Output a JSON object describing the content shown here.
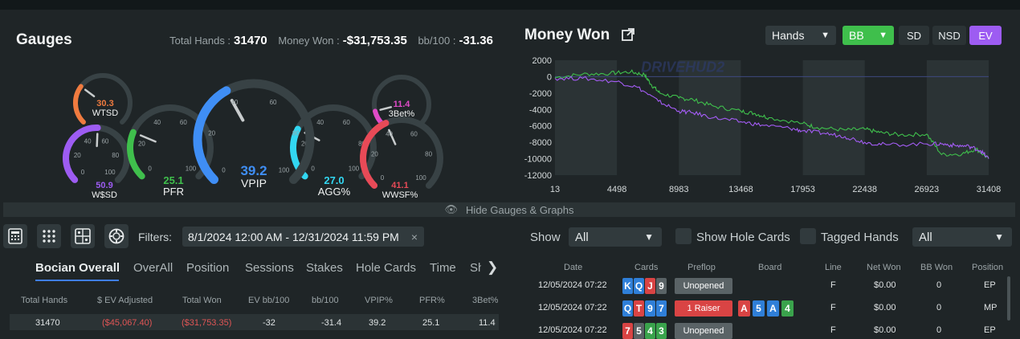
{
  "gauges": {
    "title": "Gauges",
    "total_hands_label": "Total Hands :",
    "total_hands": "31470",
    "money_won_label": "Money Won :",
    "money_won": "-$31,753.35",
    "bb100_label": "bb/100 :",
    "bb100": "-31.36",
    "items": [
      {
        "name": "WTSD",
        "value": "30.3",
        "color": "#f07b3f"
      },
      {
        "name": "W$SD",
        "value": "50.9",
        "color": "#9d5cf2"
      },
      {
        "name": "PFR",
        "value": "25.1",
        "color": "#3fbf4c"
      },
      {
        "name": "VPIP",
        "value": "39.2",
        "color": "#3f8ef5"
      },
      {
        "name": "AGG%",
        "value": "27.0",
        "color": "#32d7f2"
      },
      {
        "name": "3Bet%",
        "value": "11.4",
        "color": "#e04bc8"
      },
      {
        "name": "WWSF%",
        "value": "41.1",
        "color": "#e84a57"
      }
    ],
    "ticks": [
      "0",
      "20",
      "40",
      "60",
      "80",
      "100"
    ]
  },
  "money": {
    "title": "Money Won",
    "hands_select": "Hands",
    "bb_select": "BB",
    "sd": "SD",
    "nsd": "NSD",
    "ev": "EV",
    "watermark": "DRIVEHUD2"
  },
  "chart_data": {
    "type": "line",
    "x_ticks": [
      "13",
      "4498",
      "8983",
      "13468",
      "17953",
      "22438",
      "26923",
      "31408"
    ],
    "y_ticks": [
      "2000",
      "0",
      "-2000",
      "-4000",
      "-6000",
      "-8000",
      "-10000",
      "-12000"
    ],
    "ylim": [
      -12000,
      2000
    ],
    "xlim": [
      13,
      31408
    ],
    "series": [
      {
        "color": "#3fbf4c",
        "x": [
          13,
          2000,
          4000,
          5500,
          6500,
          7000,
          7600,
          8983,
          10000,
          11500,
          13468,
          14500,
          15500,
          17953,
          19000,
          21000,
          22438,
          23500,
          25000,
          26923,
          28000,
          29500,
          30500,
          31408
        ],
        "y": [
          -100,
          300,
          400,
          600,
          200,
          -1000,
          -2000,
          -2600,
          -2800,
          -3600,
          -4200,
          -4500,
          -5000,
          -5700,
          -6200,
          -6500,
          -6400,
          -6800,
          -7100,
          -7000,
          -9500,
          -9400,
          -8800,
          -10000
        ]
      },
      {
        "color": "#a45cf5",
        "x": [
          13,
          2000,
          4498,
          6000,
          7500,
          8983,
          10000,
          11500,
          13468,
          15000,
          17000,
          17953,
          19500,
          21000,
          22438,
          24000,
          26923,
          28000,
          29000,
          30000,
          30800,
          31408
        ],
        "y": [
          -200,
          -200,
          -600,
          -1300,
          -3000,
          -4200,
          -4400,
          -5000,
          -5500,
          -5900,
          -6300,
          -6600,
          -6900,
          -7300,
          -8000,
          -8300,
          -8200,
          -8200,
          -8400,
          -8500,
          -9000,
          -10000
        ]
      }
    ]
  },
  "hide_bar": "Hide Gauges & Graphs",
  "filters": {
    "label": "Filters:",
    "value": "8/1/2024 12:00 AM - 12/31/2024 11:59 PM",
    "clear": "×"
  },
  "stat_tabs": [
    "Bocian Overall",
    "OverAll",
    "Position",
    "Sessions",
    "Stakes",
    "Hole Cards",
    "Time",
    "Sh"
  ],
  "left_table": {
    "headers": [
      "Total Hands",
      "$ EV Adjusted",
      "Total Won",
      "EV bb/100",
      "bb/100",
      "VPIP%",
      "PFR%",
      "3Bet%"
    ],
    "row": [
      "31470",
      "($45,067.40)",
      "($31,753.35)",
      "-32",
      "-31.4",
      "39.2",
      "25.1",
      "11.4"
    ]
  },
  "hands_panel": {
    "show_label": "Show",
    "show_value": "All",
    "show_hole_cards": "Show Hole Cards",
    "tagged_hands": "Tagged Hands",
    "tagged_value": "All",
    "headers": [
      "Date",
      "Cards",
      "Preflop",
      "Board",
      "Line",
      "Net Won",
      "BB Won",
      "Position"
    ],
    "rows": [
      {
        "date": "12/05/2024 07:22",
        "cards": [
          {
            "r": "K",
            "s": "d"
          },
          {
            "r": "Q",
            "s": "d"
          },
          {
            "r": "J",
            "s": "h"
          },
          {
            "r": "9",
            "s": "s"
          }
        ],
        "preflop": "Unopened",
        "preflop_color": "#5a6366",
        "board": [],
        "line": "F",
        "net": "$0.00",
        "bb": "0",
        "pos": "EP"
      },
      {
        "date": "12/05/2024 07:22",
        "cards": [
          {
            "r": "Q",
            "s": "d"
          },
          {
            "r": "T",
            "s": "h"
          },
          {
            "r": "9",
            "s": "d"
          },
          {
            "r": "7",
            "s": "d"
          }
        ],
        "preflop": "1 Raiser",
        "preflop_color": "#d94444",
        "board": [
          {
            "r": "A",
            "s": "h"
          },
          {
            "r": "5",
            "s": "d"
          },
          {
            "r": "A",
            "s": "d"
          },
          {
            "r": "4",
            "s": "c"
          }
        ],
        "line": "F",
        "net": "$0.00",
        "bb": "0",
        "pos": "MP"
      },
      {
        "date": "12/05/2024 07:22",
        "cards": [
          {
            "r": "7",
            "s": "h"
          },
          {
            "r": "5",
            "s": "s"
          },
          {
            "r": "4",
            "s": "c"
          },
          {
            "r": "3",
            "s": "c"
          }
        ],
        "preflop": "Unopened",
        "preflop_color": "#5a6366",
        "board": [],
        "line": "F",
        "net": "$0.00",
        "bb": "0",
        "pos": "EP"
      }
    ]
  }
}
